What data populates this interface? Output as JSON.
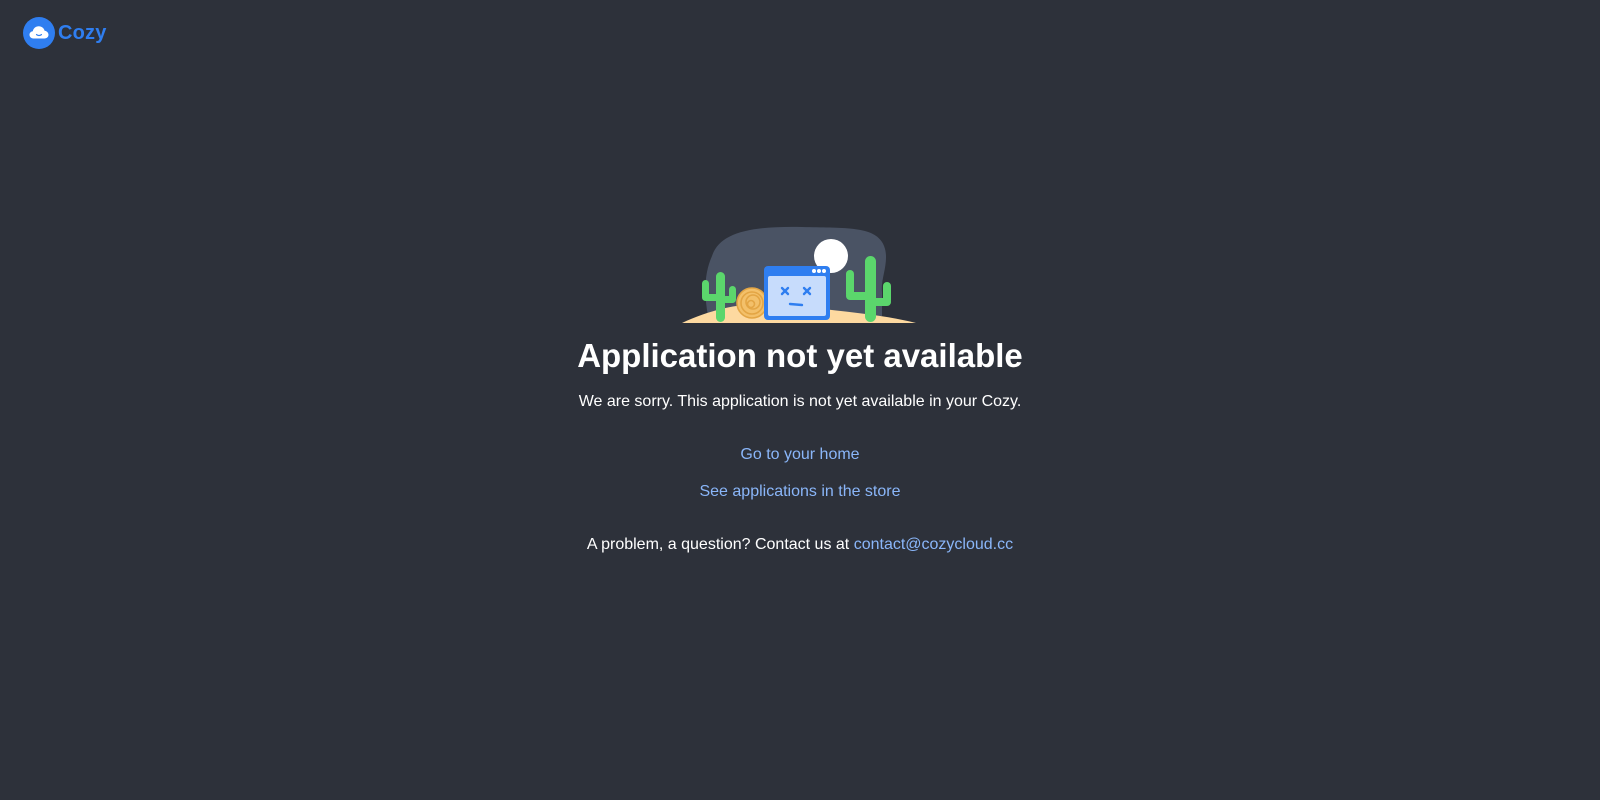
{
  "brand": {
    "name": "Cozy",
    "color": "#2f7ef0"
  },
  "error": {
    "title": "Application not yet available",
    "message": "We are sorry. This application is not yet available in your Cozy."
  },
  "links": {
    "home": "Go to your home",
    "store": "See applications in the store"
  },
  "contact": {
    "prefix": "A problem, a question? Contact us at",
    "email": "contact@cozycloud.cc"
  },
  "colors": {
    "background": "#2d313a",
    "link": "#8ab6f9",
    "cactus": "#5bd66c",
    "sand": "#fdd9a0"
  },
  "icons": {
    "logo": "cozy-cloud-logo-icon",
    "illustration": "desert-broken-window-illustration"
  }
}
